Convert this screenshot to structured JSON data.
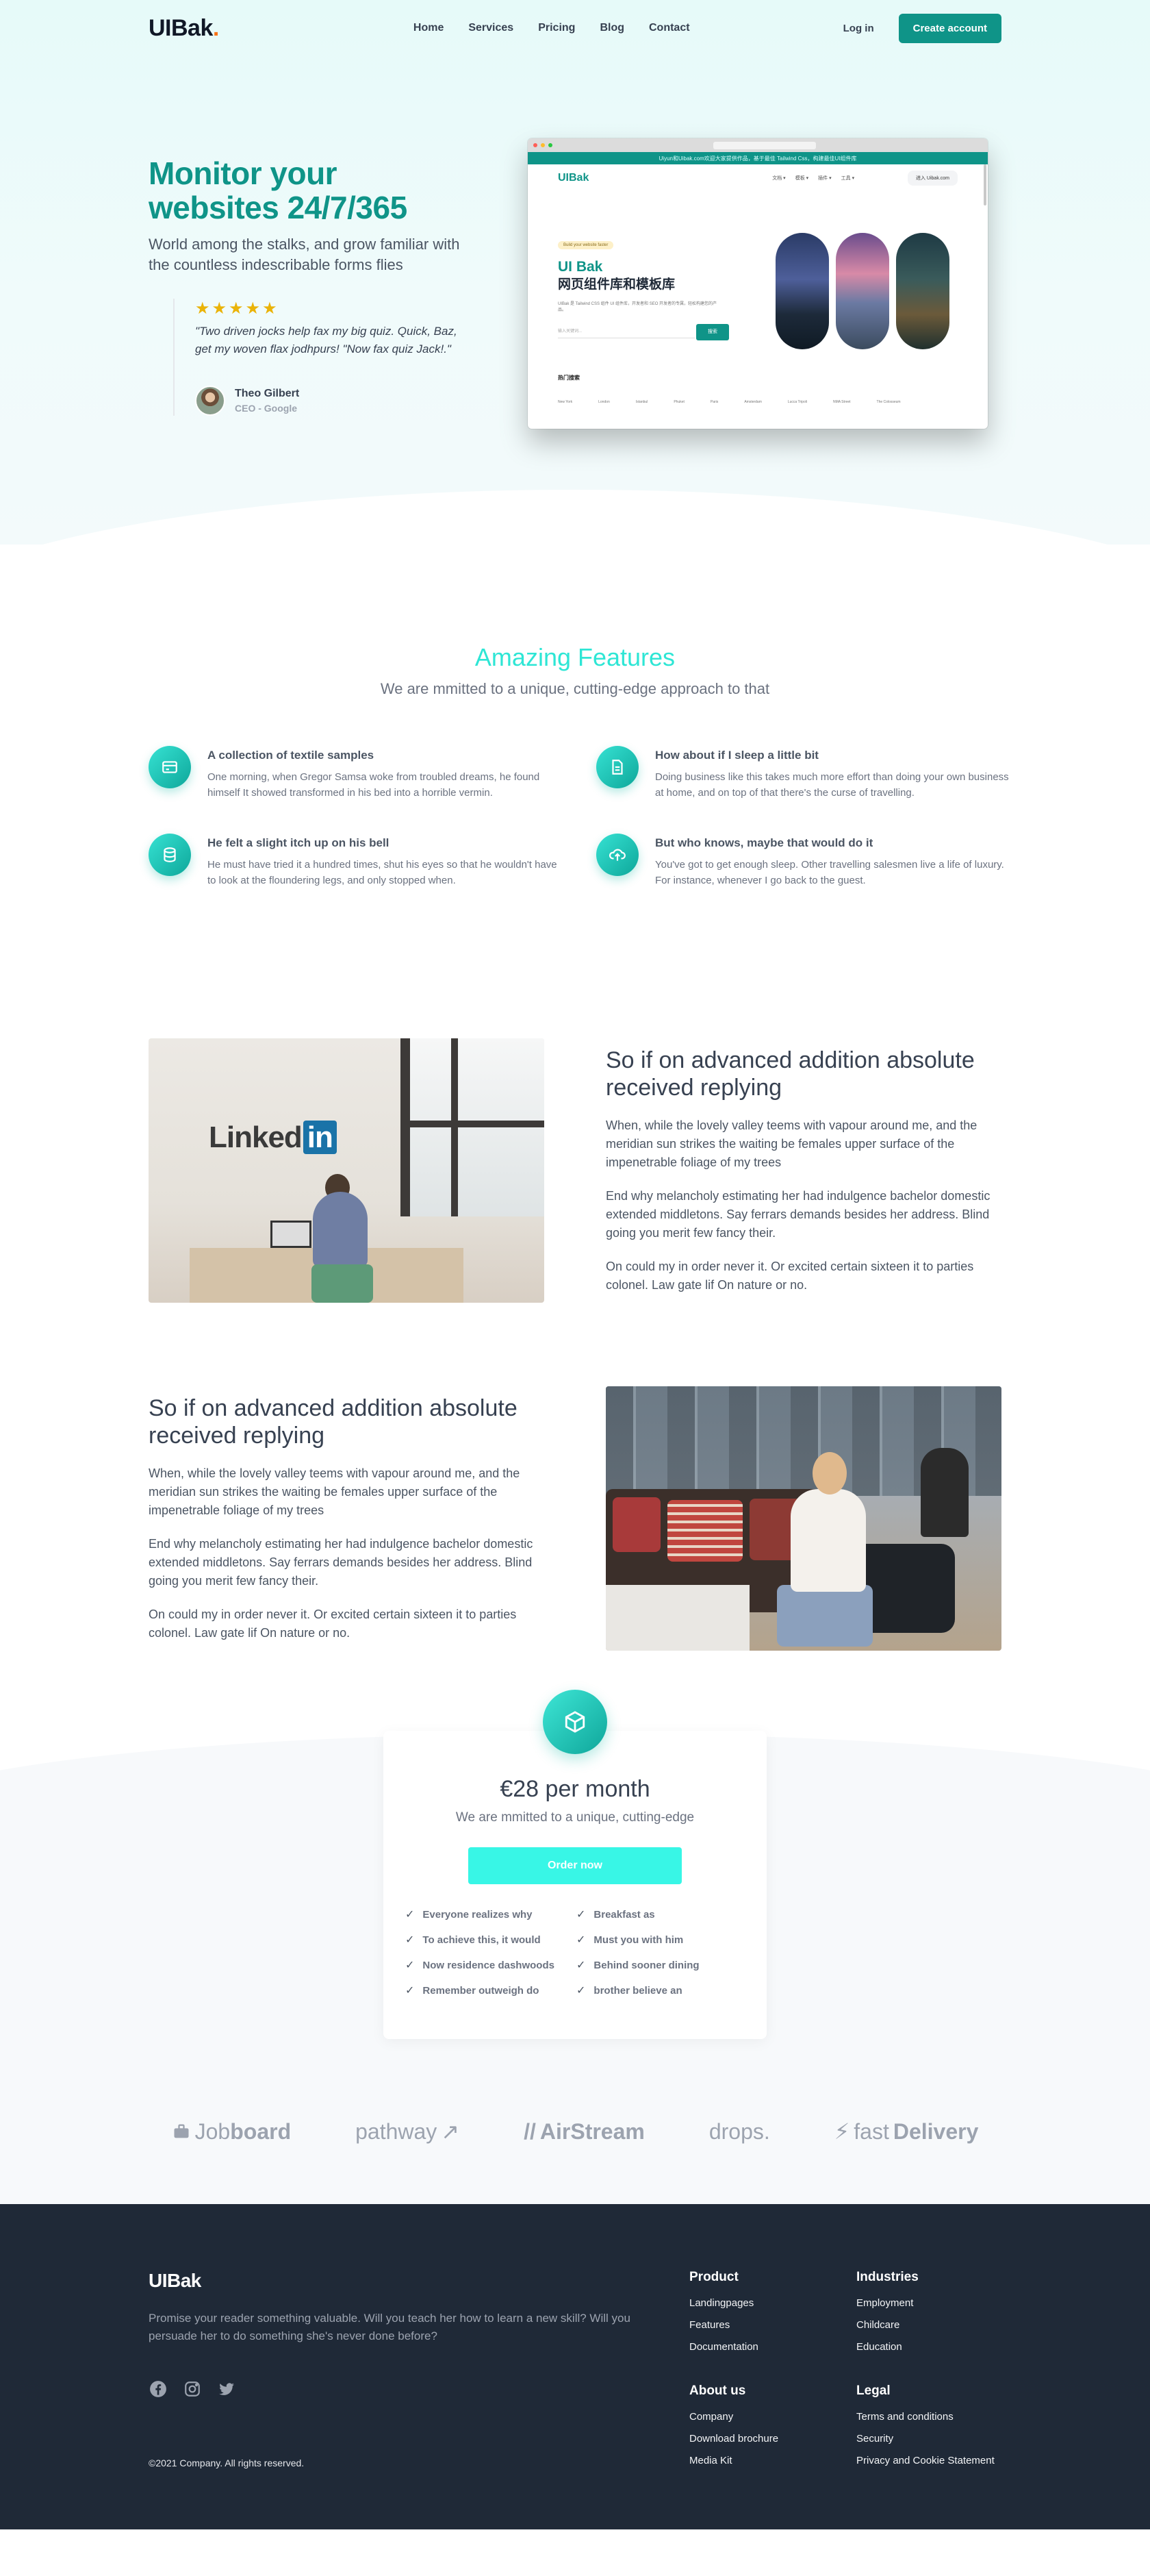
{
  "nav": {
    "logo": "UIBak",
    "logo_dot": ".",
    "links": [
      "Home",
      "Services",
      "Pricing",
      "Blog",
      "Contact"
    ],
    "login": "Log in",
    "create": "Create account"
  },
  "hero": {
    "title_line1": "Monitor your",
    "title_line2": "websites 24/7/365",
    "subtitle": "World among the stalks, and grow familiar with the countless indescribable forms flies",
    "stars": "★★★★★",
    "quote": "\"Two driven jocks help fax my big quiz. Quick, Baz, get my woven flax jodhpurs! \"Now fax quiz Jack!.\"",
    "author_name": "Theo Gilbert",
    "author_role": "CEO - Google"
  },
  "mockup": {
    "bar_text": "Uiyun和Uibak.com欢迎大家提供作品，基于最佳 Tailwind Css，构建最佳UI组件库",
    "logo": "UIBak",
    "nav_links": [
      "文档 ▾",
      "模板 ▾",
      "插件 ▾",
      "工具 ▾"
    ],
    "nav_btn": "进入 Uibak.com",
    "badge": "Build your website faster",
    "h1": "UI Bak",
    "h2": "网页组件库和模板库",
    "p": "UIBak 是 Tailwind CSS 组件 UI 组件库，开发者和 SEO 开发者的专属，轻松构建您的产品。",
    "input_placeholder": "输入关键词...",
    "search": "搜索",
    "hot": "热门搜索",
    "cities": [
      "New York",
      "London",
      "Istanbul",
      "Phuket",
      "Paris",
      "Amsterdam",
      "Lucca Tripoli",
      "NMA Street",
      "The Colosseum"
    ]
  },
  "features": {
    "title": "Amazing Features",
    "subtitle": "We are mmitted to a unique, cutting-edge approach to that",
    "items": [
      {
        "title": "A collection of textile samples",
        "text": "One morning, when Gregor Samsa woke from troubled dreams, he found himself It showed transformed in his bed into a horrible vermin.",
        "icon": "card-icon"
      },
      {
        "title": "How about if I sleep a little bit",
        "text": "Doing business like this takes much more effort than doing your own business at home, and on top of that there's the curse of travelling.",
        "icon": "document-icon"
      },
      {
        "title": "He felt a slight itch up on his bell",
        "text": "He must have tried it a hundred times, shut his eyes so that he wouldn't have to look at the floundering legs, and only stopped when.",
        "icon": "database-icon"
      },
      {
        "title": "But who knows, maybe that would do it",
        "text": "You've got to get enough sleep. Other travelling salesmen live a life of luxury. For instance, whenever I go back to the guest.",
        "icon": "cloud-upload-icon"
      }
    ]
  },
  "split1": {
    "brand": "Linked",
    "brand_in": "in",
    "title": "So if on advanced addition absolute received replying",
    "paragraphs": [
      "When, while the lovely valley teems with vapour around me, and the meridian sun strikes the waiting be females upper surface of the impenetrable foliage of my trees",
      "End why melancholy estimating her had indulgence bachelor domestic extended middletons. Say ferrars demands besides her address. Blind going you merit few fancy their.",
      "On could my in order never it. Or excited certain sixteen it to parties colonel. Law gate lif On nature or no."
    ]
  },
  "split2": {
    "title": "So if on advanced addition absolute received replying",
    "paragraphs": [
      "When, while the lovely valley teems with vapour around me, and the meridian sun strikes the waiting be females upper surface of the impenetrable foliage of my trees",
      "End why melancholy estimating her had indulgence bachelor domestic extended middletons. Say ferrars demands besides her address. Blind going you merit few fancy their.",
      "On could my in order never it. Or excited certain sixteen it to parties colonel. Law gate lif On nature or no."
    ]
  },
  "pricing": {
    "amount": "€28 per month",
    "subtitle": "We are mmitted to a unique, cutting-edge",
    "button": "Order now",
    "features": [
      "Everyone realizes why",
      "Breakfast as",
      "To achieve this, it would",
      "Must you with him",
      "Now residence dashwoods",
      "Behind sooner dining",
      "Remember outweigh do",
      "brother believe an"
    ]
  },
  "logos": {
    "jobboard_light": "Job",
    "jobboard_bold": "board",
    "pathway": "pathway",
    "airstream_prefix": "//",
    "airstream": "AirStream",
    "drops": "drops.",
    "fast": "fast",
    "delivery": "Delivery"
  },
  "footer": {
    "logo": "UIBak",
    "about": "Promise your reader something valuable. Will you teach her how to learn a new skill? Will you persuade her to do something she's never done before?",
    "copyright": "©2021 Company. All rights reserved.",
    "product": {
      "title": "Product",
      "links": [
        "Landingpages",
        "Features",
        "Documentation"
      ]
    },
    "industries": {
      "title": "Industries",
      "links": [
        "Employment",
        "Childcare",
        "Education"
      ]
    },
    "about_us": {
      "title": "About us",
      "links": [
        "Company",
        "Download brochure",
        "Media Kit"
      ]
    },
    "legal": {
      "title": "Legal",
      "links": [
        "Terms and conditions",
        "Security",
        "Privacy and Cookie Statement"
      ]
    }
  },
  "colors": {
    "accent": "#0f9488",
    "accent_light": "#2ee6d5",
    "cta": "#38f6e6",
    "footer_bg": "#1f2937",
    "star": "#eab308"
  }
}
